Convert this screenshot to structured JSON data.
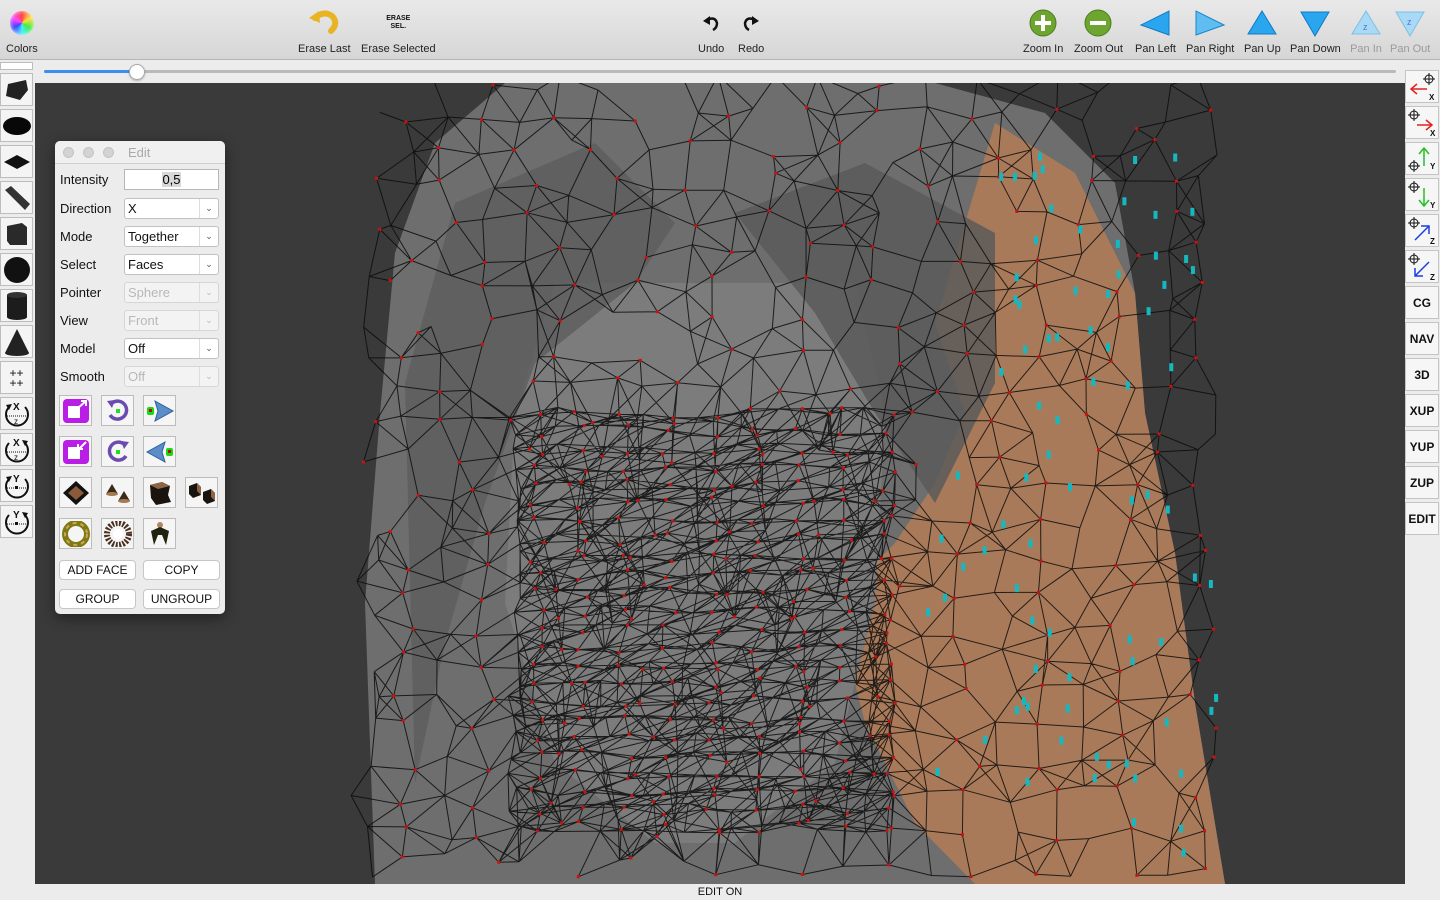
{
  "toolbar": {
    "colors": "Colors",
    "erase_last": "Erase Last",
    "erase_selected_icon_text": [
      "ERASE",
      "SEL."
    ],
    "erase_selected": "Erase Selected",
    "undo": "Undo",
    "redo": "Redo",
    "zoom_in": "Zoom In",
    "zoom_out": "Zoom Out",
    "pan_left": "Pan Left",
    "pan_right": "Pan Right",
    "pan_up": "Pan Up",
    "pan_down": "Pan Down",
    "pan_in": "Pan In",
    "pan_out": "Pan Out",
    "pan_in_disabled": true,
    "pan_out_disabled": true
  },
  "slider": {
    "value_fraction": 0.068
  },
  "left_tools": [
    {
      "name": "blank"
    },
    {
      "name": "surface-patch-icon"
    },
    {
      "name": "ellipse-icon"
    },
    {
      "name": "plane-icon"
    },
    {
      "name": "beam-icon"
    },
    {
      "name": "cube-icon"
    },
    {
      "name": "sphere-icon"
    },
    {
      "name": "cylinder-icon"
    },
    {
      "name": "cone-icon"
    },
    {
      "name": "points-grid-icon"
    },
    {
      "name": "rotate-xz-ccw-icon",
      "axis": "X",
      "sub": "Z"
    },
    {
      "name": "rotate-xz-cw-icon",
      "axis": "X",
      "sub": "Z"
    },
    {
      "name": "rotate-y-ccw-icon",
      "axis": "Y"
    },
    {
      "name": "rotate-y-cw-icon",
      "axis": "Y"
    }
  ],
  "right_tools": {
    "axis_buttons": [
      {
        "name": "move-neg-x",
        "axis": "X",
        "color": "#e02020"
      },
      {
        "name": "move-pos-x",
        "axis": "X",
        "color": "#e02020"
      },
      {
        "name": "move-pos-y",
        "axis": "Y",
        "color": "#20c020"
      },
      {
        "name": "move-neg-y",
        "axis": "Y",
        "color": "#20c020"
      },
      {
        "name": "move-pos-z",
        "axis": "Z",
        "color": "#1c3de0"
      },
      {
        "name": "move-neg-z",
        "axis": "Z",
        "color": "#1c3de0"
      }
    ],
    "text_buttons": [
      "CG",
      "NAV",
      "3D",
      "XUP",
      "YUP",
      "ZUP",
      "EDIT"
    ]
  },
  "edit_panel": {
    "title": "Edit",
    "intensity_label": "Intensity",
    "intensity_value": "0,5",
    "direction_label": "Direction",
    "direction_value": "X",
    "mode_label": "Mode",
    "mode_value": "Together",
    "select_label": "Select",
    "select_value": "Faces",
    "pointer_label": "Pointer",
    "pointer_value": "Sphere",
    "view_label": "View",
    "view_value": "Front",
    "model_label": "Model",
    "model_value": "Off",
    "smooth_label": "Smooth",
    "smooth_value": "Off",
    "add_face": "ADD FACE",
    "copy": "COPY",
    "group": "GROUP",
    "ungroup": "UNGROUP"
  },
  "status": "EDIT ON",
  "colors": {
    "viewport_bg": "#3a3a3a",
    "mesh_gray": "#6e6e6e",
    "mesh_skin": "#a97a5a",
    "vertex": "#cc1111",
    "selected_marker": "#16b8c0",
    "accent": "#3b8ef0"
  }
}
